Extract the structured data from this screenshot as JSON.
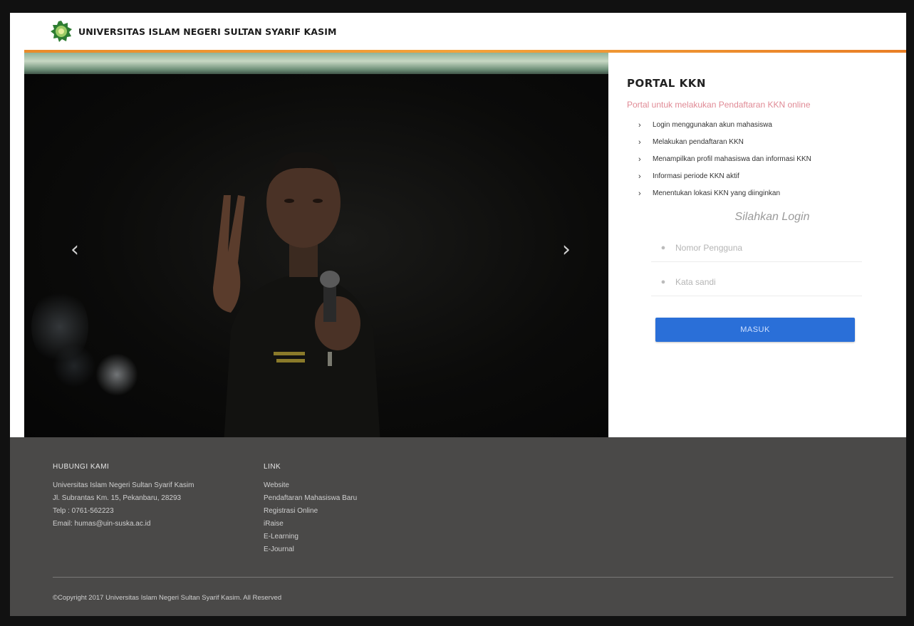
{
  "header": {
    "brand": "UNIVERSITAS ISLAM NEGERI SULTAN SYARIF KASIM"
  },
  "slider": {
    "prev_label": "‹",
    "next_label": "›"
  },
  "panel": {
    "title": "PORTAL KKN",
    "subtitle": "Portal untuk melakukan Pendaftaran KKN online",
    "features": [
      "Login menggunakan akun mahasiswa",
      "Melakukan pendaftaran KKN",
      "Menampilkan profil mahasiswa dan informasi KKN",
      "Informasi periode KKN aktif",
      "Menentukan lokasi KKN yang diinginkan"
    ],
    "login_heading": "Silahkan Login",
    "username_placeholder": "Nomor Pengguna",
    "password_placeholder": "Kata sandi",
    "submit_label": "MASUK"
  },
  "footer": {
    "contact": {
      "heading": "HUBUNGI KAMI",
      "lines": [
        "Universitas Islam Negeri Sultan Syarif Kasim",
        "Jl. Subrantas Km. 15, Pekanbaru, 28293",
        "Telp : 0761-562223",
        "Email: humas@uin-suska.ac.id"
      ]
    },
    "links": {
      "heading": "LINK",
      "items": [
        "Website",
        "Pendaftaran Mahasiswa Baru",
        "Registrasi Online",
        "iRaise",
        "E-Learning",
        "E-Journal"
      ]
    },
    "copyright": "©Copyright 2017 Universitas Islam Negeri Sultan Syarif Kasim. All Reserved"
  }
}
